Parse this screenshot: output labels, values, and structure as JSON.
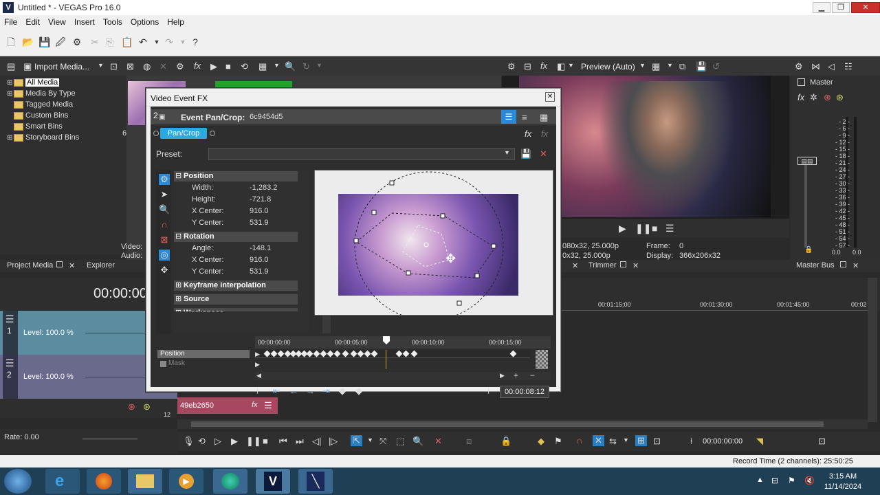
{
  "window": {
    "title": "Untitled * - VEGAS Pro 16.0",
    "logo": "V",
    "minimize": "▁",
    "maximize": "❐",
    "close": "✕"
  },
  "menu": [
    "File",
    "Edit",
    "View",
    "Insert",
    "Tools",
    "Options",
    "Help"
  ],
  "media_panel": {
    "import_label": "Import Media...",
    "tree": [
      {
        "label": "All Media",
        "selected": true,
        "expander": "⊞"
      },
      {
        "label": "Media By Type",
        "expander": "⊞"
      },
      {
        "label": "Tagged Media",
        "expander": ""
      },
      {
        "label": "Custom Bins",
        "expander": ""
      },
      {
        "label": "Smart Bins",
        "expander": ""
      },
      {
        "label": "Storyboard Bins",
        "expander": "⊞"
      }
    ],
    "thumb_label": "6",
    "video_label": "Video:",
    "audio_label": "Audio:"
  },
  "tabs_left": {
    "project_media": "Project Media",
    "explorer": "Explorer"
  },
  "fx_window": {
    "title": "Video Event FX",
    "close": "✕",
    "chain_index": "2",
    "event_label": "Event Pan/Crop:",
    "event_id": "6c9454d5",
    "pill": "Pan/Crop",
    "preset_label": "Preset:",
    "sections": {
      "position": "Position",
      "rotation": "Rotation",
      "keyframe": "Keyframe interpolation",
      "source": "Source",
      "workspace": "Workspace"
    },
    "position": [
      {
        "name": "Width:",
        "value": "-1,283.2"
      },
      {
        "name": "Height:",
        "value": "-721.8"
      },
      {
        "name": "X Center:",
        "value": "916.0"
      },
      {
        "name": "Y Center:",
        "value": "531.9"
      }
    ],
    "rotation": [
      {
        "name": "Angle:",
        "value": "-148.1"
      },
      {
        "name": "X Center:",
        "value": "916.0"
      },
      {
        "name": "Y Center:",
        "value": "531.9"
      }
    ],
    "ruler": [
      "00:00:00;00",
      "00:00:05;00",
      "00:00:10;00",
      "00:00:15;00"
    ],
    "kf_rows": {
      "position": "Position",
      "mask": "Mask"
    },
    "timecode": "00:00:08:12"
  },
  "preview": {
    "label": "Preview (Auto)",
    "info_left_1": "080x32, 25.000p",
    "info_left_2": "0x32, 25.000p",
    "frame_label": "Frame:",
    "frame_value": "0",
    "display_label": "Display:",
    "display_value": "366x206x32",
    "trimmer_tab": "Trimmer"
  },
  "master": {
    "label": "Master",
    "meter_scale": [
      "- 2 -",
      "- 6 -",
      "- 9 -",
      "- 12 -",
      "- 15 -",
      "- 18 -",
      "- 21 -",
      "- 24 -",
      "- 27 -",
      "- 30 -",
      "- 33 -",
      "- 36 -",
      "- 39 -",
      "- 42 -",
      "- 45 -",
      "- 48 -",
      "- 51 -",
      "- 54 -",
      "- 57 -"
    ],
    "levels": [
      "0.0",
      "0.0"
    ],
    "bus_tab": "Master Bus"
  },
  "timeline": {
    "time_display": "00:00:00",
    "ruler": [
      "00:01:15;00",
      "00:01:30;00",
      "00:01:45;00",
      "00:02"
    ],
    "tracks": [
      {
        "num": "1",
        "level": "Level: 100.0 %"
      },
      {
        "num": "2",
        "level": "Level: 100.0 %"
      }
    ],
    "clip_name": "49eb2650",
    "clip_fx": "fx",
    "rate": "Rate: 0.00",
    "transport_time": "00:00:00:00",
    "track_marker": "12"
  },
  "status": {
    "record_time": "Record Time (2 channels): 25:50:25"
  },
  "clock": {
    "time": "3:15 AM",
    "date": "11/14/2024"
  }
}
